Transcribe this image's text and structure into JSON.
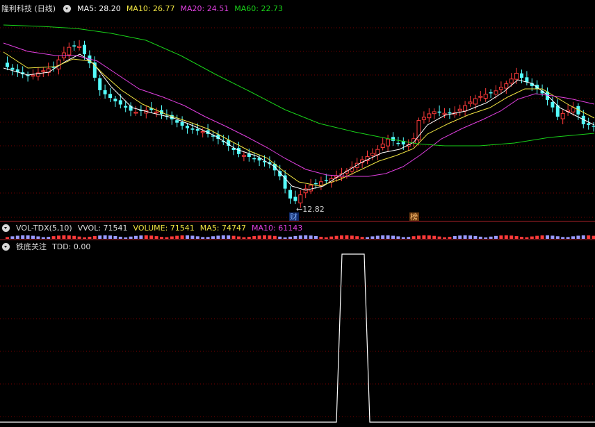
{
  "main": {
    "stock_title": "隆利科技 (日线)",
    "ma5_label": "MA5: 28.20",
    "ma10_label": "MA10: 26.77",
    "ma20_label": "MA20: 24.51",
    "ma60_label": "MA60: 22.73",
    "low_marker": "←12.82",
    "badge_cai": "财",
    "badge_bang": "榜",
    "colors": {
      "ma5": "#ffffff",
      "ma10": "#f0e442",
      "ma20": "#e040e0",
      "ma60": "#19d219",
      "up": "#ff3a3a",
      "down": "#54fcfc",
      "grid": "#7a0000"
    }
  },
  "volume": {
    "indicator": "VOL-TDX(5,10)",
    "vvol_label": "VVOL: 71541",
    "volume_label": "VOLUME: 71541",
    "ma5_label": "MA5: 74747",
    "ma10_label": "MA10: 61143"
  },
  "tdd": {
    "indicator": "铁底关注",
    "value_label": "TDD: 0.00"
  }
}
